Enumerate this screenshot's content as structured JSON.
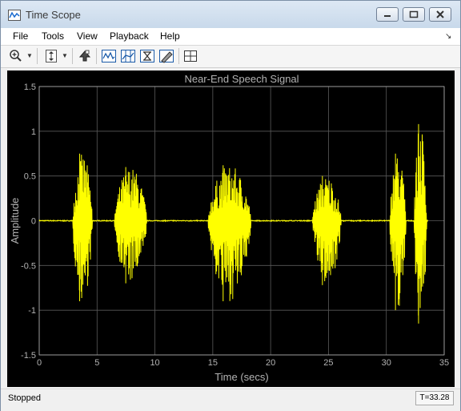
{
  "window": {
    "title": "Time Scope"
  },
  "menu": [
    "File",
    "Tools",
    "View",
    "Playback",
    "Help"
  ],
  "toolbar": {
    "buttons": [
      "zoom-in-icon",
      "autoscale-icon",
      "restore-default-icon",
      "triggers-icon",
      "cursor-measurements-icon",
      "peak-finder-icon",
      "bilevel-measurements-icon",
      "signal-statistics-icon",
      "layout-icon"
    ]
  },
  "status": {
    "text": "Stopped",
    "time": "T=33.28"
  },
  "colors": {
    "trace": "#ffff00",
    "axes_bg": "#000000",
    "grid": "#5a5a5a",
    "axis_text": "#b3b3b3"
  },
  "chart_data": {
    "type": "line",
    "title": "Near-End Speech Signal",
    "xlabel": "Time (secs)",
    "ylabel": "Amplitude",
    "xlim": [
      0,
      35
    ],
    "ylim": [
      -1.5,
      1.5
    ],
    "xticks": [
      0,
      5,
      10,
      15,
      20,
      25,
      30,
      35
    ],
    "yticks": [
      -1.5,
      -1,
      -0.5,
      0,
      0.5,
      1,
      1.5
    ],
    "grid": true,
    "series": [
      {
        "color": "#ffff00",
        "bursts": [
          {
            "start": 2.9,
            "end": 4.6,
            "peak_pos": 0.75,
            "peak_neg": -0.9
          },
          {
            "start": 6.5,
            "end": 9.3,
            "peak_pos": 0.6,
            "peak_neg": -0.7
          },
          {
            "start": 14.6,
            "end": 18.3,
            "peak_pos": 0.62,
            "peak_neg": -0.9
          },
          {
            "start": 23.6,
            "end": 26.1,
            "peak_pos": 0.5,
            "peak_neg": -0.72
          },
          {
            "start": 30.3,
            "end": 31.7,
            "peak_pos": 0.75,
            "peak_neg": -1.0
          },
          {
            "start": 32.4,
            "end": 33.5,
            "peak_pos": 1.08,
            "peak_neg": -1.15
          }
        ]
      }
    ]
  }
}
